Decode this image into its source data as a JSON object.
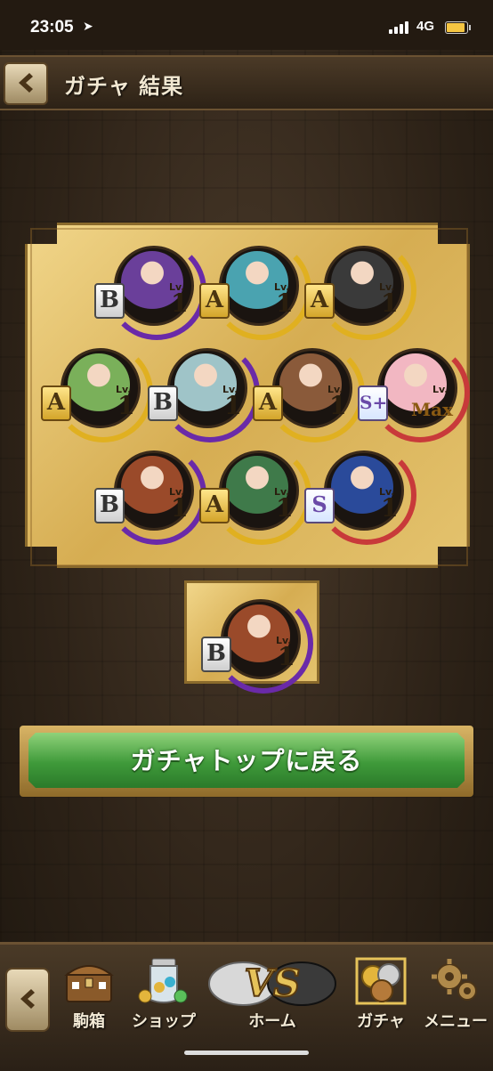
{
  "status_bar": {
    "time": "23:05",
    "network": "4G"
  },
  "header": {
    "title": "ガチャ 結果"
  },
  "results": {
    "characters": [
      {
        "rank": "B",
        "level_label": "Lv.",
        "level": "1",
        "portrait": "purple-crystal-dragon",
        "color": "#6a3f9a"
      },
      {
        "rank": "A",
        "level_label": "Lv.",
        "level": "1",
        "portrait": "teal-hair-maiden",
        "color": "#4aa3b0"
      },
      {
        "rank": "A",
        "level_label": "Lv.",
        "level": "1",
        "portrait": "dark-armored-beast",
        "color": "#3a3a3a"
      },
      {
        "rank": "A",
        "level_label": "Lv.",
        "level": "1",
        "portrait": "green-hair-girl",
        "color": "#7ab05a"
      },
      {
        "rank": "B",
        "level_label": "Lv.",
        "level": "1",
        "portrait": "pale-fish-monster",
        "color": "#9fc4c8"
      },
      {
        "rank": "A",
        "level_label": "Lv.",
        "level": "1",
        "portrait": "fox-ear-warrior",
        "color": "#8a5a3a"
      },
      {
        "rank": "S+",
        "level_label": "Lv.",
        "level": "Max",
        "portrait": "flower-crown-girl",
        "color": "#f2b7c2"
      },
      {
        "rank": "B",
        "level_label": "Lv.",
        "level": "1",
        "portrait": "steampunk-hat-boy",
        "color": "#9a4a2a"
      },
      {
        "rank": "A",
        "level_label": "Lv.",
        "level": "1",
        "portrait": "green-fox-girl",
        "color": "#3f7a4a"
      },
      {
        "rank": "S",
        "level_label": "Lv.",
        "level": "1",
        "portrait": "blue-dragon",
        "color": "#2a4a9a"
      }
    ],
    "highlight": {
      "rank": "B",
      "level_label": "Lv.",
      "level": "1",
      "portrait": "steampunk-hat-boy",
      "color": "#9a4a2a"
    }
  },
  "actions": {
    "back_to_gacha_top": "ガチャトップに戻る"
  },
  "bottom_nav": [
    {
      "label": "駒箱",
      "icon": "treasure-chest-icon"
    },
    {
      "label": "ショップ",
      "icon": "coin-jar-icon"
    },
    {
      "label": "ホーム",
      "icon": "vs-icon"
    },
    {
      "label": "ガチャ",
      "icon": "gacha-coins-icon"
    },
    {
      "label": "メニュー",
      "icon": "gear-icon"
    }
  ]
}
